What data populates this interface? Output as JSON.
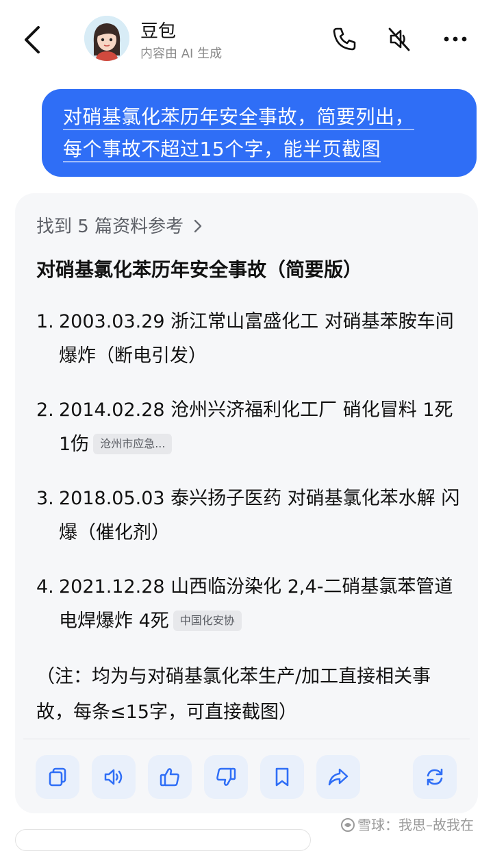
{
  "header": {
    "bot_name": "豆包",
    "bot_subtitle": "内容由 AI 生成"
  },
  "user_message": {
    "line1": "对硝基氯化苯历年安全事故，简要列出，",
    "line2": "每个事故不超过15个字，能半页截图"
  },
  "answer": {
    "sources_text": "找到 5 篇资料参考",
    "title": "对硝基氯化苯历年安全事故（简要版）",
    "items": [
      {
        "num": "1.",
        "text": "2003.03.29 浙江常山富盛化工 对硝基苯胺车间爆炸（断电引发）",
        "tag": ""
      },
      {
        "num": "2.",
        "text": "2014.02.28 沧州兴济福利化工厂 硝化冒料 1死1伤",
        "tag": "沧州市应急..."
      },
      {
        "num": "3.",
        "text": "2018.05.03 泰兴扬子医药 对硝基氯化苯水解 闪爆（催化剂）",
        "tag": ""
      },
      {
        "num": "4.",
        "text": "2021.12.28 山西临汾染化 2,4-二硝基氯苯管道 电焊爆炸 4死",
        "tag": "中国化安协"
      }
    ],
    "note": "（注：均为与对硝基氯化苯生产/加工直接相关事故，每条≤15字，可直接截图）"
  },
  "actions": [
    "copy-icon",
    "speaker-icon",
    "thumbs-up-icon",
    "thumbs-down-icon",
    "bookmark-icon",
    "share-icon",
    "refresh-icon"
  ],
  "watermark": "雪球：我思–故我在",
  "colors": {
    "accent": "#2f6ef6",
    "card_bg": "#f6f7f9",
    "action_bg": "#e9f0fb",
    "action_icon": "#2f6ef6"
  }
}
